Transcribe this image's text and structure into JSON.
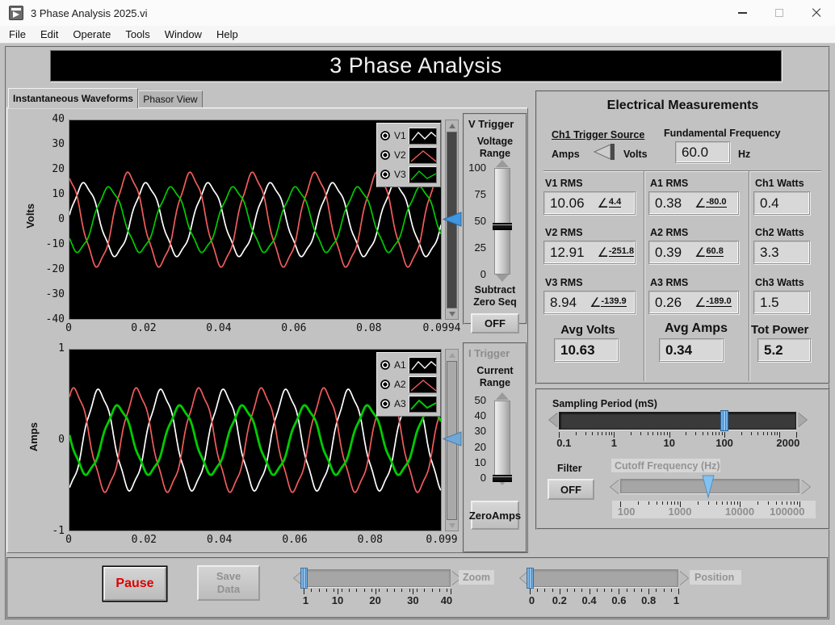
{
  "window": {
    "title": "3 Phase Analysis 2025.vi"
  },
  "menu": {
    "items": [
      "File",
      "Edit",
      "Operate",
      "Tools",
      "Window",
      "Help"
    ]
  },
  "banner": {
    "title": "3 Phase Analysis"
  },
  "tabs": {
    "active": "Instantaneous Waveforms",
    "inactive": "Phasor View"
  },
  "chart_data": [
    {
      "type": "line",
      "title": "Instantaneous voltage waveforms",
      "ylabel": "Volts",
      "ylim": [
        -40,
        40
      ],
      "yticks": [
        40,
        30,
        20,
        10,
        0,
        -10,
        -20,
        -30,
        -40
      ],
      "xticks": [
        0,
        0.02,
        0.04,
        0.06,
        0.08,
        0.0994
      ],
      "xtick_labels": [
        "0",
        "0.02",
        "0.04",
        "0.06",
        "0.08",
        "0.0994"
      ],
      "x_end": 0.0994,
      "frequency_hz": 60,
      "grid": false,
      "legend_position": "top-right",
      "series": [
        {
          "name": "V1",
          "color": "#ffffff",
          "rms": 10.06,
          "phase_deg": 4.4
        },
        {
          "name": "V2",
          "color": "#f25c5c",
          "rms": 12.91,
          "phase_deg": -251.8
        },
        {
          "name": "V3",
          "color": "#00cc00",
          "rms": 8.94,
          "phase_deg": -139.9
        }
      ]
    },
    {
      "type": "line",
      "title": "Instantaneous current waveforms",
      "ylabel": "Amps",
      "ylim": [
        -1,
        1
      ],
      "yticks": [
        1,
        0,
        -1
      ],
      "xticks": [
        0,
        0.02,
        0.04,
        0.06,
        0.08,
        0.099
      ],
      "xtick_labels": [
        "0",
        "0.02",
        "0.04",
        "0.06",
        "0.08",
        "0.099"
      ],
      "x_end": 0.099,
      "frequency_hz": 60,
      "grid": false,
      "legend_position": "top-right",
      "series": [
        {
          "name": "A1",
          "color": "#ffffff",
          "rms": 0.38,
          "phase_deg": -80.0
        },
        {
          "name": "A2",
          "color": "#f25c5c",
          "rms": 0.39,
          "phase_deg": 60.8
        },
        {
          "name": "A3",
          "color": "#00cc00",
          "rms": 0.26,
          "phase_deg": -189.0
        }
      ]
    }
  ],
  "triggers": {
    "v": {
      "title": "V Trigger",
      "range_label_1": "Voltage",
      "range_label_2": "Range",
      "subtract_1": "Subtract",
      "subtract_2": "Zero Seq",
      "off_label": "OFF"
    },
    "i": {
      "title": "I Trigger",
      "range_label_1": "Current",
      "range_label_2": "Range",
      "zero_1": "Zero",
      "zero_2": "Amps"
    }
  },
  "measurements": {
    "title": "Electrical Measurements",
    "trigger_source": {
      "label": "Ch1 Trigger Source",
      "left": "Amps",
      "right": "Volts",
      "selected": "Volts"
    },
    "fundamental": {
      "label": "Fundamental Frequency",
      "value": "60.0",
      "unit": "Hz"
    },
    "cells": [
      {
        "label": "V1 RMS",
        "value": "10.06",
        "angle": "4.4"
      },
      {
        "label": "A1 RMS",
        "value": "0.38",
        "angle": "-80.0"
      },
      {
        "label": "Ch1 Watts",
        "value": "0.4"
      },
      {
        "label": "V2 RMS",
        "value": "12.91",
        "angle": "-251.8"
      },
      {
        "label": "A2 RMS",
        "value": "0.39",
        "angle": "60.8"
      },
      {
        "label": "Ch2 Watts",
        "value": "3.3"
      },
      {
        "label": "V3 RMS",
        "value": "8.94",
        "angle": "-139.9"
      },
      {
        "label": "A3 RMS",
        "value": "0.26",
        "angle": "-189.0"
      },
      {
        "label": "Ch3 Watts",
        "value": "1.5"
      }
    ],
    "averages": [
      {
        "label": "Avg Volts",
        "value": "10.63"
      },
      {
        "label": "Avg Amps",
        "value": "0.34"
      },
      {
        "label": "Tot Power",
        "value": "5.2"
      }
    ]
  },
  "sampling": {
    "label": "Sampling Period (mS)"
  },
  "filter": {
    "label": "Filter",
    "off_label": "OFF"
  },
  "cutoff": {
    "label": "Cutoff Frequency (Hz)"
  },
  "bottom": {
    "pause": "Pause",
    "save_1": "Save",
    "save_2": "Data",
    "zoom_label": "Zoom",
    "position_label": "Position"
  },
  "sliders": {
    "voltage_range": {
      "min": 0,
      "max": 100,
      "value": 45,
      "scale": "linear",
      "ticks": [
        "100",
        "75",
        "50",
        "25",
        "0"
      ]
    },
    "current_range": {
      "min": 0,
      "max": 50,
      "value": 0,
      "scale": "linear",
      "ticks": [
        "50",
        "40",
        "30",
        "20",
        "10",
        "0"
      ]
    },
    "sampling": {
      "min": 0.1,
      "max": 2000,
      "value": 100,
      "scale": "log",
      "ticks": [
        "0.1",
        "1",
        "10",
        "100",
        "2000"
      ]
    },
    "cutoff": {
      "min": 100,
      "max": 100000,
      "value": 3000,
      "scale": "log",
      "ticks": [
        "100",
        "1000",
        "10000",
        "100000"
      ]
    },
    "zoom": {
      "min": 1,
      "max": 40,
      "value": 1,
      "scale": "linear",
      "minor": 2,
      "ticks": [
        "1",
        "10",
        "20",
        "30",
        "40"
      ]
    },
    "position": {
      "min": 0,
      "max": 1,
      "value": 0,
      "scale": "linear",
      "minor": 0.05,
      "ticks": [
        "0",
        "0.2",
        "0.4",
        "0.6",
        "0.8",
        "1"
      ]
    }
  }
}
